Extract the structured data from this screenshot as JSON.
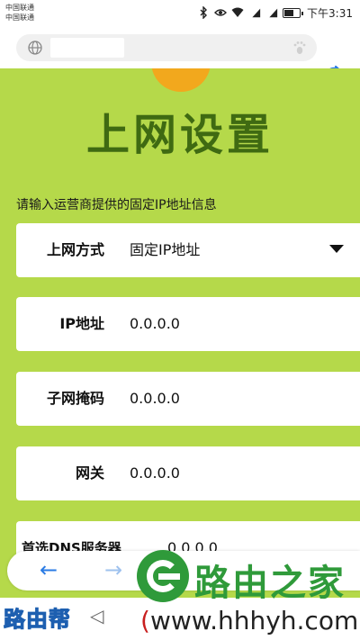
{
  "status_bar": {
    "carrier_1": "中国联通",
    "carrier_2": "中国联通",
    "signal_1": "4G",
    "signal_2": "2G",
    "time": "下午3:31",
    "battery_level": 0.55
  },
  "browser": {
    "url": "",
    "back_symbol": "←",
    "forward_symbol": "→"
  },
  "page": {
    "title": "上网设置",
    "instruction": "请输入运营商提供的固定IP地址信息",
    "fields": [
      {
        "label": "上网方式",
        "value": "固定IP地址"
      },
      {
        "label": "IP地址",
        "value": "0.0.0.0"
      },
      {
        "label": "子网掩码",
        "value": "0.0.0.0"
      },
      {
        "label": "网关",
        "value": "0.0.0.0"
      },
      {
        "label": "首选DNS服务器",
        "value": "0.0.0.0"
      }
    ]
  },
  "watermark": {
    "brand": "路由之家",
    "url_open": "(",
    "url": "www.hhhyh.com",
    "url_close": ")",
    "help": "路由帮",
    "help_arrow": "◁"
  },
  "colors": {
    "page_bg": "#b5d94a",
    "title": "#3f6a12",
    "accent_blue": "#2a7be4",
    "brand_green": "#2f9a3a"
  }
}
